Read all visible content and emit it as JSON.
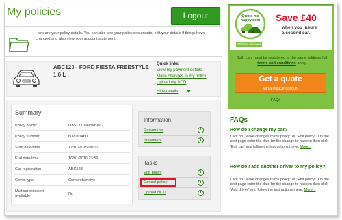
{
  "header": {
    "title": "My policies",
    "logout_label": "Logout"
  },
  "intro": {
    "text": "Here are your policy details. You can also see your policy documents, edit your details if things have changed and also view your account statement.",
    "icon": "folder-icon"
  },
  "policy": {
    "name": "ABC123 - FORD FIESTA FREESTYLE 1.6 L",
    "icon": "car-icon",
    "quick_links": {
      "title": "Quick links",
      "items": [
        {
          "label": "View my payment details"
        },
        {
          "label": "Make changes to my policy"
        },
        {
          "label": "Upload my NCD"
        }
      ],
      "hide_details": "Hide details"
    }
  },
  "summary": {
    "title": "Summary",
    "rows": [
      {
        "label": "Policy holder",
        "value": "IanSLJY DevWBWG"
      },
      {
        "label": "Policy number",
        "value": "602061460"
      },
      {
        "label": "Start date/time",
        "value": "17/01/2015 00:00"
      },
      {
        "label": "End date/time",
        "value": "16/01/2016 23:59"
      },
      {
        "label": "Car registration",
        "value": "ABC123"
      },
      {
        "label": "Cover type",
        "value": "Comprehensive"
      },
      {
        "label": "Multicar discount available",
        "value": "No"
      }
    ]
  },
  "information": {
    "title": "Information",
    "links": [
      {
        "label": "Documents"
      },
      {
        "label": "Statement"
      }
    ]
  },
  "tasks": {
    "title": "Tasks",
    "links": [
      {
        "label": "Edit policy"
      },
      {
        "label": "Cancel policy"
      },
      {
        "label": "Upload NCD"
      }
    ],
    "highlight_color": "#e2142a"
  },
  "promo": {
    "badge_text_line1": "Quote me",
    "badge_text_line2": "happy.com",
    "tag": "Multicar discount",
    "save": "Save £40",
    "save_sub_line1": "when you insure",
    "save_sub_line2": "a second car.",
    "text_before": "Both cars must be registered to the same address full ",
    "terms_link": "terms and conditions",
    "text_after": " apply",
    "quote_button": "Get a quote",
    "quote_sub": "with a Multicar discount",
    "faqs_link": "FAQs"
  },
  "faqs": {
    "title": "FAQs",
    "items": [
      {
        "question": "How do I change my car?",
        "answer": "Click on \"Make changes to my policy\" or \"Edit policy\". On the next page enter the date for the change to happen then click \"Edit car\" and follow the instructions there.",
        "more": "More..."
      },
      {
        "question": "How do I add another driver to my policy?",
        "answer": "Click on \"Make changes to my policy\" or \"Edit policy\". On the next page enter the date for the change to happen then click \"Add driver\" and follow the instructions there.",
        "more": "More..."
      }
    ]
  },
  "colors": {
    "brand_green": "#2a7a10",
    "button_green": "#2f9a1f",
    "promo_green": "#7fc241",
    "accent_red": "#e2142a",
    "cta_orange": "#f2851a"
  }
}
